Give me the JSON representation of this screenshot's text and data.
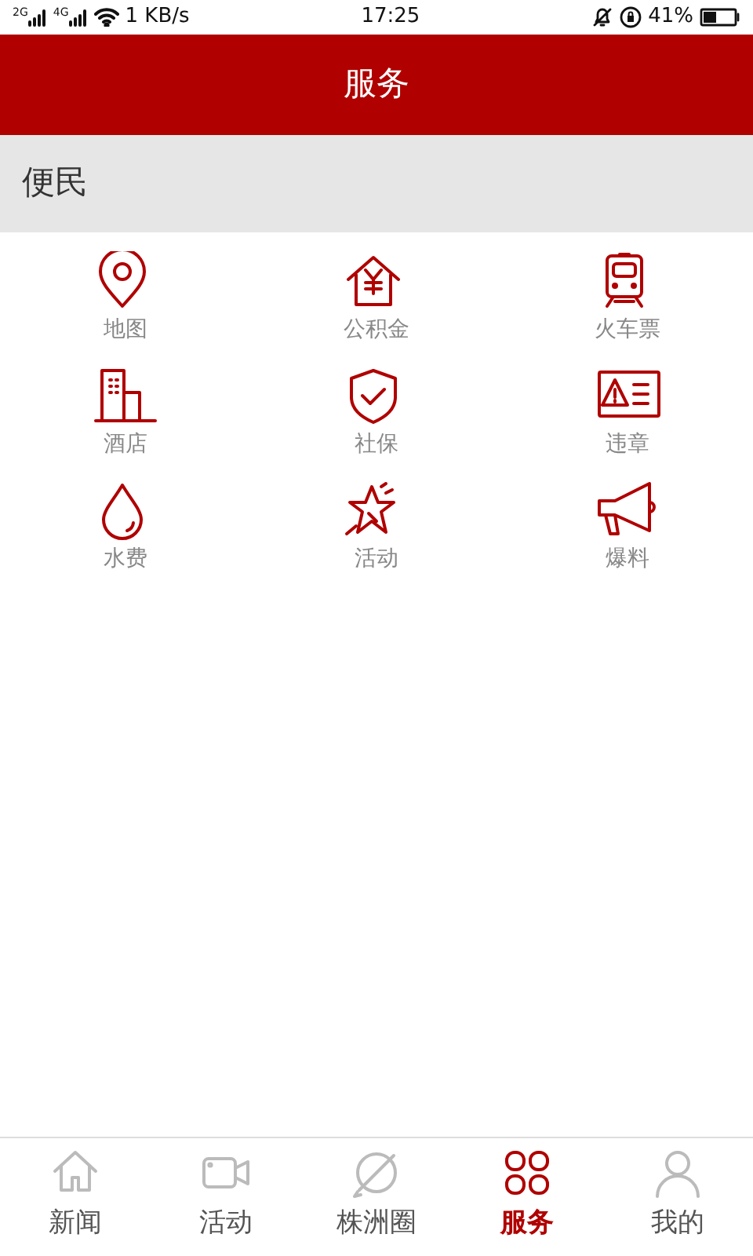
{
  "status_bar": {
    "network_1": "2G",
    "network_2": "4G",
    "speed": "1 KB/s",
    "time": "17:25",
    "battery": "41%"
  },
  "header": {
    "title": "服务"
  },
  "section": {
    "title": "便民"
  },
  "services": [
    {
      "label": "地图"
    },
    {
      "label": "公积金"
    },
    {
      "label": "火车票"
    },
    {
      "label": "酒店"
    },
    {
      "label": "社保"
    },
    {
      "label": "违章"
    },
    {
      "label": "水费"
    },
    {
      "label": "活动"
    },
    {
      "label": "爆料"
    }
  ],
  "tabs": [
    {
      "label": "新闻",
      "selected": false
    },
    {
      "label": "活动",
      "selected": false
    },
    {
      "label": "株洲圈",
      "selected": false
    },
    {
      "label": "服务",
      "selected": true
    },
    {
      "label": "我的",
      "selected": false
    }
  ]
}
